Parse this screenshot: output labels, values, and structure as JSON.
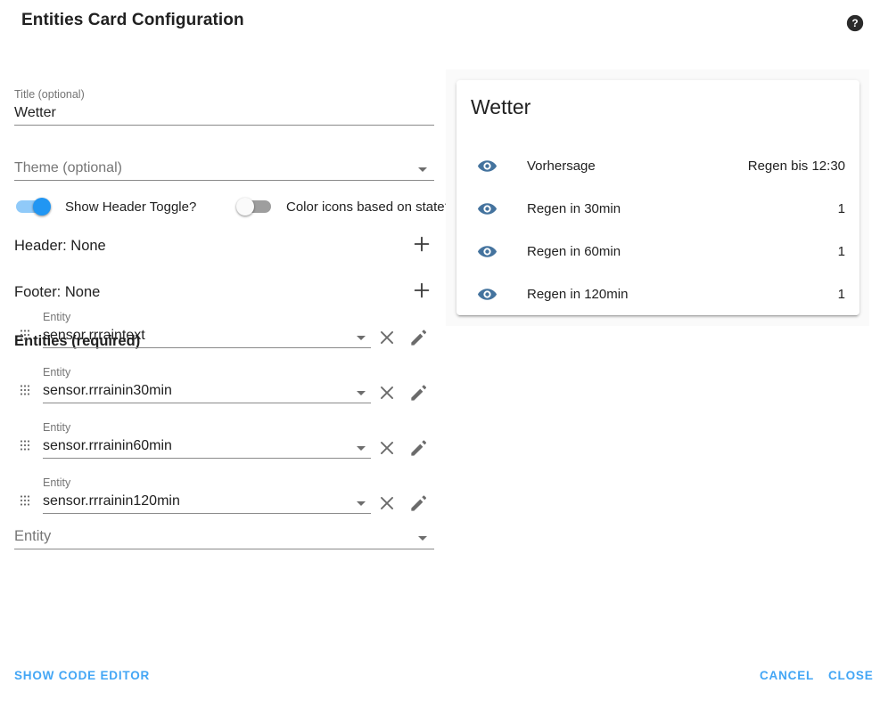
{
  "dialog": {
    "title": "Entities Card Configuration",
    "help_icon": "help-circle-icon"
  },
  "config": {
    "title_field": {
      "label": "Title (optional)",
      "value": "Wetter"
    },
    "theme_field": {
      "label": "Theme (optional)",
      "value": "",
      "placeholder": "Theme (optional)",
      "caret_icon": "chevron-down-icon"
    },
    "toggles": [
      {
        "label": "Show Header Toggle?",
        "state": "on"
      },
      {
        "label": "Color icons based on state?",
        "state": "off"
      }
    ],
    "header_row": {
      "label": "Header: None",
      "add_icon": "plus-icon"
    },
    "footer_row": {
      "label": "Footer: None",
      "add_icon": "plus-icon"
    },
    "entities_heading": "Entities (required)",
    "entity_rows": [
      {
        "label": "Entity",
        "value": "sensor.rrraintext",
        "drag_icon": "drag-handle-icon",
        "remove_icon": "close-icon",
        "edit_icon": "pencil-icon"
      },
      {
        "label": "Entity",
        "value": "sensor.rrrainin30min",
        "drag_icon": "drag-handle-icon",
        "remove_icon": "close-icon",
        "edit_icon": "pencil-icon"
      },
      {
        "label": "Entity",
        "value": "sensor.rrrainin60min",
        "drag_icon": "drag-handle-icon",
        "remove_icon": "close-icon",
        "edit_icon": "pencil-icon"
      },
      {
        "label": "Entity",
        "value": "sensor.rrrainin120min",
        "drag_icon": "drag-handle-icon",
        "remove_icon": "close-icon",
        "edit_icon": "pencil-icon"
      }
    ],
    "entity_picker_empty": {
      "placeholder": "Entity",
      "caret_icon": "chevron-down-icon"
    }
  },
  "preview": {
    "card_title": "Wetter",
    "rows": [
      {
        "icon": "eye-icon",
        "name": "Vorhersage",
        "state": "Regen bis 12:30"
      },
      {
        "icon": "eye-icon",
        "name": "Regen in 30min",
        "state": "1"
      },
      {
        "icon": "eye-icon",
        "name": "Regen in 60min",
        "state": "1"
      },
      {
        "icon": "eye-icon",
        "name": "Regen in 120min",
        "state": "1"
      }
    ]
  },
  "actions": {
    "show_code_editor": "SHOW CODE EDITOR",
    "cancel": "CANCEL",
    "close": "CLOSE"
  },
  "colors": {
    "accent": "#43a6f5",
    "toggle_on_thumb": "#2196f3",
    "toggle_on_track": "#90caf9",
    "toggle_off_track": "#9e9e9e",
    "state_icon": "#44739e",
    "text_primary": "#212121",
    "text_secondary": "#757575",
    "preview_bg": "#fafafa"
  }
}
